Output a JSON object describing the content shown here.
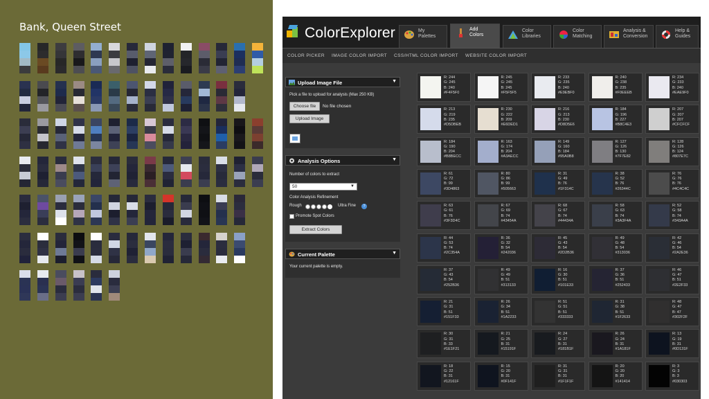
{
  "left_panel": {
    "title": "Bank, Queen Street",
    "background": "#6b6a37",
    "swatch_strips": [
      [
        [
          "#83c6e7",
          "#8cc8e8",
          "#a2b9c4",
          "#3b3b3d"
        ],
        [
          "#262728",
          "#2d2c2d",
          "#6a4a23",
          "#593a1e"
        ],
        [
          "#3d3c3f",
          "#353538",
          "#272727",
          "#2b2a2c"
        ],
        [
          "#5d5c61",
          "#2e2d30",
          "#19191b",
          "#4d4d52"
        ],
        [
          "#93aed1",
          "#2e3852",
          "#8a9fc0",
          "#4a5876"
        ],
        [
          "#d8d8dc",
          "#3c3c41",
          "#c7c7cc",
          "#69696e"
        ],
        [
          "#26283a",
          "#585c6c",
          "#1e2030",
          "#4e5263"
        ],
        [
          "#cfd4e0",
          "#5f6575",
          "#252633",
          "#e9eaee"
        ],
        [
          "#1e2131",
          "#202331",
          "#5e5f6a",
          "#2a2c3a"
        ],
        [
          "#f1f1f2",
          "#232428",
          "#26272c",
          "#1a1b20"
        ],
        [
          "#8a4c66",
          "#5c5c6a",
          "#2a2b36",
          "#3a3b47"
        ],
        [
          "#262838",
          "#3a3d52",
          "#222434",
          "#5e6072"
        ],
        [
          "#2a6fae",
          "#1b2f5f",
          "#1f2d53",
          "#2c3e72"
        ],
        [
          "#f4b43a",
          "#2f5ba8",
          "#b4cfe1",
          "#bfe35a"
        ]
      ],
      [
        [
          "#2a3250",
          "#222a42",
          "#c9cde0",
          "#22253a"
        ],
        [
          "#4a4a4f",
          "#232428",
          "#54555a",
          "#9a9aa0"
        ],
        [
          "#25314f",
          "#1e2b4c",
          "#222438",
          "#4b4b54"
        ],
        [
          "#9b8b84",
          "#272932",
          "#e6e0d8",
          "#5a4f4c"
        ],
        [
          "#1a2a55",
          "#223466",
          "#2b3a66",
          "#8a98b5"
        ],
        [
          "#3b5f6a",
          "#2a3a48",
          "#546a80",
          "#3a4958"
        ],
        [
          "#4c5570",
          "#252735",
          "#a6b3cc",
          "#2a2c3a"
        ],
        [
          "#d3d8e8",
          "#2a2e42",
          "#3a3e52",
          "#282a38"
        ],
        [
          "#20223a",
          "#262945",
          "#2e3048",
          "#c0c8de"
        ],
        [
          "#5a5c6a",
          "#25273a",
          "#283a5e",
          "#1e2034"
        ],
        [
          "#2d3a52",
          "#a2b8d6",
          "#1f2842",
          "#2b3449"
        ],
        [
          "#7a2f3f",
          "#2a2a35",
          "#5e3845",
          "#2f2f3a"
        ],
        [
          "#2a2c3c",
          "#23253a",
          "#b2b8cc",
          "#e5e8ee"
        ]
      ],
      [
        [
          "#2a2c3a",
          "#3c3e52",
          "#262837",
          "#2e3042"
        ],
        [
          "#9a9aa0",
          "#2a2b33",
          "#c5c5cb",
          "#262730"
        ],
        [
          "#cfd6e6",
          "#262838",
          "#5a6278",
          "#2f3245"
        ],
        [
          "#2f3248",
          "#d6dbe8",
          "#24263a",
          "#6f7a96"
        ],
        [
          "#3a4562",
          "#4f7fbf",
          "#263553",
          "#7b86a0"
        ],
        [
          "#1e2030",
          "#5c6277",
          "#22243a",
          "#3e4256"
        ],
        [
          "#1c2a48",
          "#2c3e62",
          "#1a2440",
          "#263655"
        ],
        [
          "#d8c8d6",
          "#3a3a48",
          "#d98b9c",
          "#4b4c5e"
        ],
        [
          "#2a2c3e",
          "#d6dbe8",
          "#262839",
          "#353849"
        ],
        [
          "#2c2b44",
          "#3a3854",
          "#2a2840",
          "#23223a"
        ],
        [
          "#0f1013",
          "#141519",
          "#101114",
          "#15161a"
        ],
        [
          "#23253a",
          "#1a2e5c",
          "#1f5faa",
          "#2a3c62"
        ],
        [
          "#18161a",
          "#0f0e12",
          "#1a181c",
          "#141317"
        ],
        [
          "#8b3f2e",
          "#5a3a36",
          "#7c4030",
          "#3b2a2a"
        ]
      ],
      [
        [
          "#e9ebf0",
          "#2b2d3b",
          "#c7cbd6",
          "#242634"
        ],
        [
          "#24263a",
          "#2a2c3e",
          "#1e2032",
          "#262838"
        ],
        [
          "#2a2c3d",
          "#9e8a8a",
          "#3a3c4e",
          "#4a4c5e"
        ],
        [
          "#dfe3ec",
          "#2e3447",
          "#4c5a7c",
          "#23273a"
        ],
        [
          "#2b2d3e",
          "#3a4058",
          "#25283a",
          "#22253a"
        ],
        [
          "#262838",
          "#3d4158",
          "#222433",
          "#5e6275"
        ],
        [
          "#2a2c3b",
          "#24263a",
          "#1f2234",
          "#272a3c"
        ],
        [
          "#7a3a48",
          "#3a2a30",
          "#2a1f24",
          "#4a2f36"
        ],
        [
          "#25283a",
          "#4d5a7a",
          "#2a2c3f",
          "#202334"
        ],
        [
          "#3d3f52",
          "#e5e8ee",
          "#d34a5e",
          "#3a3c4e"
        ],
        [
          "#2a2c3b",
          "#2b2d3e",
          "#26283a",
          "#3b3d50"
        ],
        [
          "#dadfe8",
          "#2d3042",
          "#272a3a",
          "#2a2d3f"
        ],
        [
          "#1f2132",
          "#2c2f44",
          "#9aa3ba",
          "#2a2c3d"
        ],
        [
          "#3a3c4e",
          "#b0a8b8",
          "#2a2c3a",
          "#3b3d50"
        ]
      ],
      [
        [
          "#2a2c3d",
          "#1e2030",
          "#24263a",
          "#2b2d3e"
        ],
        [
          "#4a5268",
          "#6e4aa0",
          "#3a3e58",
          "#2b2d3e"
        ],
        [
          "#9aa0b2",
          "#2a2c3e",
          "#dde1ea",
          "#ffffff"
        ],
        [
          "#9aa3ba",
          "#2a2c3b",
          "#b6a7b8",
          "#2f3245"
        ],
        [
          "#3a4666",
          "#24304d",
          "#c0c8de",
          "#2c3754"
        ],
        [
          "#252838",
          "#d0d4e0",
          "#1c1e2e",
          "#2f3246"
        ],
        [
          "#262838",
          "#d9dde8",
          "#24263a",
          "#3b3e52"
        ],
        [
          "#2a2c3e",
          "#1c1e2e",
          "#24263a",
          "#23253a"
        ],
        [
          "#d4342a",
          "#262838",
          "#2a2c3d",
          "#1a1c2a"
        ],
        [
          "#262838",
          "#3a3c4e",
          "#d2d6e2",
          "#282a3b"
        ],
        [
          "#0d0e12",
          "#101116",
          "#0f1014",
          "#121318"
        ],
        [
          "#d9dde6",
          "#3a3c52",
          "#24304d",
          "#283553"
        ],
        [
          "#2a2838",
          "#2b2d3e",
          "#3a3046",
          "#262838"
        ]
      ],
      [
        [
          "#2b2d3e",
          "#24263a",
          "#2a2c3d",
          "#20223a"
        ],
        [
          "#ffffff",
          "#2b2d3d",
          "#2f3144",
          "#e6e9ef"
        ],
        [
          "#2a2c3c",
          "#23253a",
          "#6e7a96",
          "#1c1e2e"
        ],
        [
          "#0c0d10",
          "#121318",
          "#3a3c4e",
          "#101116"
        ],
        [
          "#ffffff",
          "#2a2c3d",
          "#2b2d3e",
          "#d6dbe7"
        ],
        [
          "#2a2c3e",
          "#d1d7e4",
          "#2f3245",
          "#262838"
        ],
        [
          "#26283a",
          "#2b2d3e",
          "#1f2134",
          "#2a2c3d"
        ],
        [
          "#e3e6ed",
          "#3a4660",
          "#90a7c8",
          "#d9c9b0"
        ],
        [
          "#24263a",
          "#2b2d3e",
          "#2a2c3d",
          "#202234"
        ],
        [
          "#2a2c3d",
          "#1e2032",
          "#3a3c4e",
          "#262838"
        ],
        [
          "#3a2a2e",
          "#24263a",
          "#2a2c3d",
          "#332a33"
        ],
        [
          "#d6d2cc",
          "#2b2d3e",
          "#2a2c3d",
          "#e9ebf0"
        ],
        [
          "#8aa0c8",
          "#3b4b70",
          "#2a3a5f",
          "#ffffff"
        ]
      ],
      [
        [
          "#d9ddea",
          "#2a3354",
          "#2a3256",
          "#2f3758"
        ],
        [
          "#e8ebf0",
          "#2a3050",
          "#2b3455",
          "#6a6f88"
        ],
        [
          "#4a4c5e",
          "#6a5a6a",
          "#2a2c3e",
          "#3b3d50"
        ],
        [
          "#c8c2c8",
          "#3a3c52",
          "#2b2d3e",
          "#3b3d50"
        ],
        [
          "#2a2c3d",
          "#2d3a60",
          "#e0e4ec",
          "#2a3352"
        ],
        [
          "#cdd2de",
          "#2a2c3e",
          "#3c3e52",
          "#a18a7a"
        ]
      ]
    ],
    "strip_column_x": [
      [
        28,
        54,
        80,
        106,
        131,
        157,
        183,
        209,
        235,
        261,
        287,
        312,
        338,
        364
      ],
      [
        28,
        54,
        80,
        106,
        131,
        157,
        183,
        209,
        235,
        261,
        287,
        312,
        338
      ],
      [
        28,
        54,
        80,
        106,
        131,
        157,
        183,
        209,
        235,
        261,
        287,
        312,
        338,
        364
      ],
      [
        28,
        54,
        80,
        106,
        131,
        157,
        183,
        209,
        235,
        261,
        287,
        312,
        338,
        364
      ],
      [
        28,
        54,
        80,
        106,
        131,
        157,
        183,
        209,
        235,
        261,
        287,
        312,
        338
      ],
      [
        28,
        54,
        80,
        106,
        131,
        157,
        183,
        209,
        235,
        261,
        287,
        312,
        338
      ],
      [
        28,
        54,
        80,
        106,
        131,
        157
      ]
    ]
  },
  "app": {
    "brand": "ColorExplorer",
    "tabs": [
      {
        "label": "My\nPalettes",
        "icon": "palette-icon",
        "active": false
      },
      {
        "label": "Add\nColors",
        "icon": "paintbrush-icon",
        "active": true
      },
      {
        "label": "Color\nLibraries",
        "icon": "library-icon",
        "active": false
      },
      {
        "label": "Color\nMatching",
        "icon": "color-wheel-icon",
        "active": false
      },
      {
        "label": "Analysis &\nConversion",
        "icon": "analysis-icon",
        "active": false
      },
      {
        "label": "Help &\nGuides",
        "icon": "lifebuoy-icon",
        "active": false
      }
    ],
    "subnav": [
      "COLOR PICKER",
      "IMAGE COLOR IMPORT",
      "CSS/HTML COLOR IMPORT",
      "WEBSITE COLOR IMPORT"
    ],
    "upload_panel": {
      "title": "Upload Image File",
      "instruction": "Pick a file to upload for analysis (Max 250 KB)",
      "choose_file": "Choose file",
      "no_file": "No file chosen",
      "upload_button": "Upload Image"
    },
    "analysis_panel": {
      "title": "Analysis Options",
      "colors_label": "Number of colors to extract",
      "colors_value": "50",
      "refinement_label": "Color Analysis Refinement",
      "rough": "Rough",
      "ultra_fine": "Ultra Fine",
      "promote": "Promote Spot Colors",
      "extract_button": "Extract Colors"
    },
    "palette_panel": {
      "title": "Current Palette",
      "empty_text": "Your current palette is empty."
    },
    "colors": [
      {
        "r": 244,
        "g": 245,
        "b": 240,
        "hex": "#F4F5F0"
      },
      {
        "r": 245,
        "g": 245,
        "b": 245,
        "hex": "#F5F5F5"
      },
      {
        "r": 233,
        "g": 235,
        "b": 240,
        "hex": "#E9EBF0"
      },
      {
        "r": 240,
        "g": 238,
        "b": 235,
        "hex": "#F0EEEB"
      },
      {
        "r": 234,
        "g": 233,
        "b": 240,
        "hex": "#EAE9F0"
      },
      {
        "r": 213,
        "g": 219,
        "b": 235,
        "hex": "#D5DBEB"
      },
      {
        "r": 230,
        "g": 222,
        "b": 209,
        "hex": "#E6DED1"
      },
      {
        "r": 216,
        "g": 213,
        "b": 230,
        "hex": "#D8D5E6"
      },
      {
        "r": 184,
        "g": 196,
        "b": 227,
        "hex": "#B8C4E3"
      },
      {
        "r": 207,
        "g": 207,
        "b": 207,
        "hex": "#CFCFCF"
      },
      {
        "r": 184,
        "g": 190,
        "b": 204,
        "hex": "#B8BECC"
      },
      {
        "r": 163,
        "g": 174,
        "b": 204,
        "hex": "#A3AECC"
      },
      {
        "r": 149,
        "g": 160,
        "b": 184,
        "hex": "#95A0B8"
      },
      {
        "r": 127,
        "g": 126,
        "b": 130,
        "hex": "#7F7E82"
      },
      {
        "r": 128,
        "g": 126,
        "b": 124,
        "hex": "#807E7C"
      },
      {
        "r": 61,
        "g": 72,
        "b": 99,
        "hex": "#3D4863"
      },
      {
        "r": 80,
        "g": 86,
        "b": 99,
        "hex": "#505663"
      },
      {
        "r": 31,
        "g": 49,
        "b": 76,
        "hex": "#1F314C"
      },
      {
        "r": 38,
        "g": 52,
        "b": 76,
        "hex": "#26344C"
      },
      {
        "r": 76,
        "g": 76,
        "b": 76,
        "hex": "#4C4C4C"
      },
      {
        "r": 63,
        "g": 61,
        "b": 76,
        "hex": "#3F3D4C"
      },
      {
        "r": 67,
        "g": 69,
        "b": 74,
        "hex": "#43454A"
      },
      {
        "r": 68,
        "g": 67,
        "b": 74,
        "hex": "#44434A"
      },
      {
        "r": 58,
        "g": 63,
        "b": 74,
        "hex": "#3A3F4A"
      },
      {
        "r": 52,
        "g": 58,
        "b": 74,
        "hex": "#343A4A"
      },
      {
        "r": 44,
        "g": 53,
        "b": 74,
        "hex": "#2C354A"
      },
      {
        "r": 36,
        "g": 32,
        "b": 54,
        "hex": "#242036"
      },
      {
        "r": 45,
        "g": 43,
        "b": 54,
        "hex": "#2D2B36"
      },
      {
        "r": 49,
        "g": 48,
        "b": 54,
        "hex": "#313036"
      },
      {
        "r": 42,
        "g": 46,
        "b": 54,
        "hex": "#2A2E36"
      },
      {
        "r": 37,
        "g": 43,
        "b": 54,
        "hex": "#252B36"
      },
      {
        "r": 49,
        "g": 49,
        "b": 51,
        "hex": "#313133"
      },
      {
        "r": 16,
        "g": 30,
        "b": 51,
        "hex": "#101E33"
      },
      {
        "r": 37,
        "g": 36,
        "b": 51,
        "hex": "#252433"
      },
      {
        "r": 46,
        "g": 47,
        "b": 51,
        "hex": "#2E2F33"
      },
      {
        "r": 21,
        "g": 31,
        "b": 51,
        "hex": "#151F33"
      },
      {
        "r": 26,
        "g": 34,
        "b": 51,
        "hex": "#1A2233"
      },
      {
        "r": 51,
        "g": 51,
        "b": 51,
        "hex": "#333333"
      },
      {
        "r": 31,
        "g": 38,
        "b": 51,
        "hex": "#1F2633"
      },
      {
        "r": 48,
        "g": 47,
        "b": 47,
        "hex": "#302F2F"
      },
      {
        "r": 30,
        "g": 31,
        "b": 33,
        "hex": "#1E1F21"
      },
      {
        "r": 21,
        "g": 25,
        "b": 31,
        "hex": "#15191F"
      },
      {
        "r": 24,
        "g": 27,
        "b": 31,
        "hex": "#181B1F"
      },
      {
        "r": 26,
        "g": 24,
        "b": 31,
        "hex": "#1A181F"
      },
      {
        "r": 13,
        "g": 19,
        "b": 31,
        "hex": "#0D131F"
      },
      {
        "r": 18,
        "g": 22,
        "b": 31,
        "hex": "#12161F"
      },
      {
        "r": 15,
        "g": 20,
        "b": 31,
        "hex": "#0F141F"
      },
      {
        "r": 31,
        "g": 31,
        "b": 31,
        "hex": "#1F1F1F"
      },
      {
        "r": 20,
        "g": 20,
        "b": 20,
        "hex": "#141414"
      },
      {
        "r": 3,
        "g": 3,
        "b": 3,
        "hex": "#030303"
      }
    ]
  }
}
